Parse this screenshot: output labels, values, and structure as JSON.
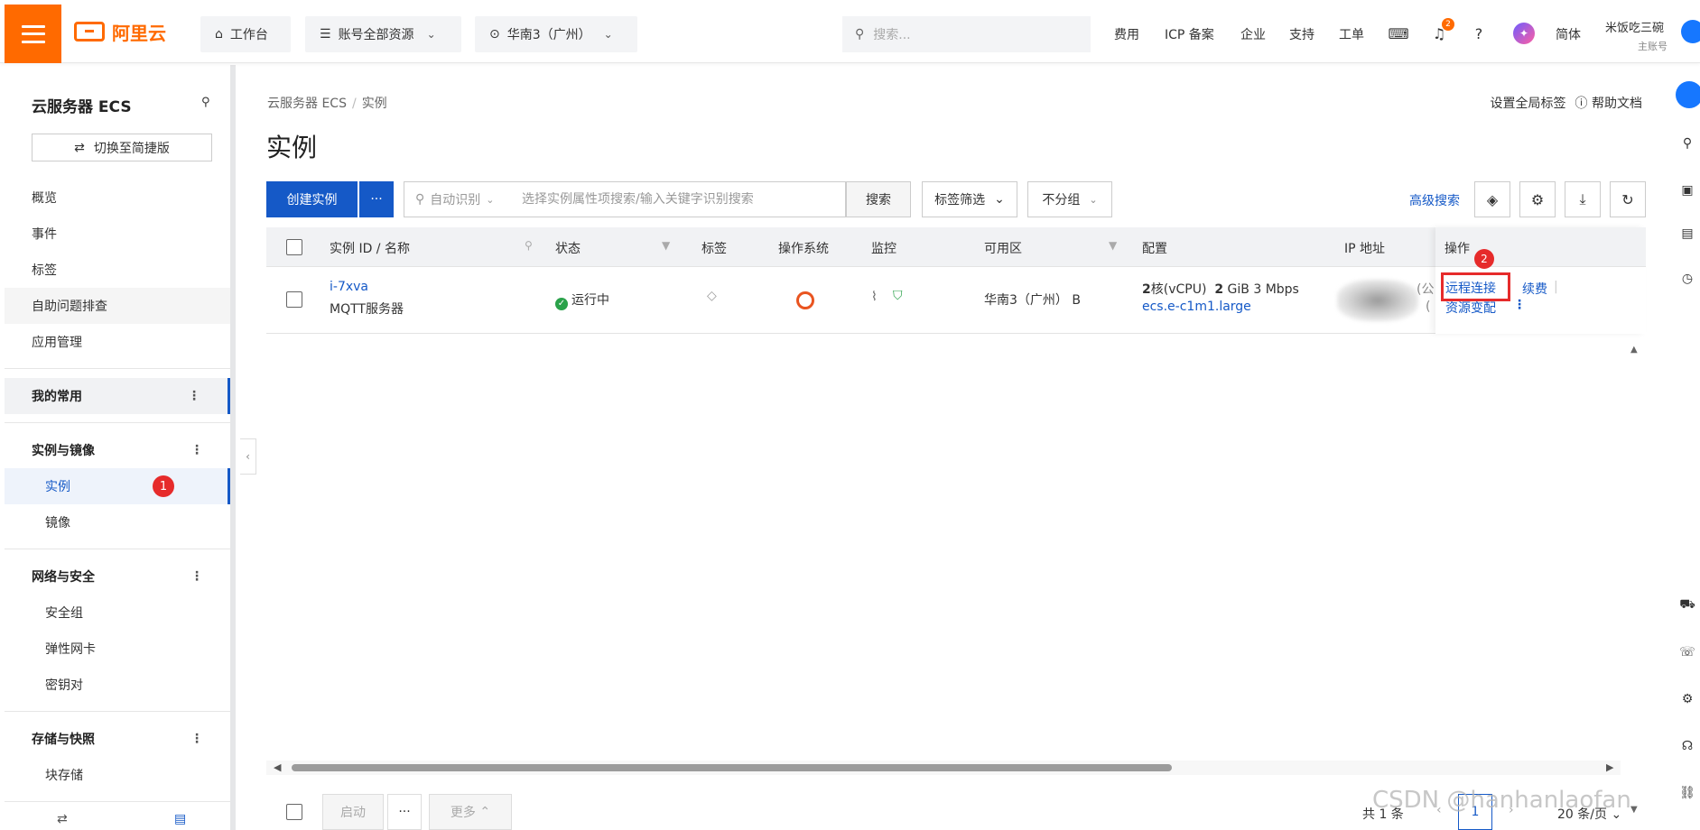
{
  "topbar": {
    "logo_text": "阿里云",
    "workbench": "工作台",
    "resources": "账号全部资源",
    "region": "华南3（广州）",
    "search_placeholder": "搜索...",
    "links": [
      "费用",
      "ICP 备案",
      "企业",
      "支持",
      "工单"
    ],
    "notif_count": "2",
    "lang": "简体",
    "user_name": "米饭吃三碗",
    "user_role": "主账号"
  },
  "sidebar": {
    "title": "云服务器 ECS",
    "switch_label": "切换至简捷版",
    "items": [
      "概览",
      "事件",
      "标签",
      "自助问题排查",
      "应用管理"
    ],
    "favorites": "我的常用",
    "group_instances": "实例与镜像",
    "instances": "实例",
    "images": "镜像",
    "group_network": "网络与安全",
    "security_group": "安全组",
    "eni": "弹性网卡",
    "keypair": "密钥对",
    "group_storage": "存储与快照",
    "block_storage": "块存储",
    "step1": "1"
  },
  "main": {
    "breadcrumb": [
      "云服务器 ECS",
      "实例"
    ],
    "title": "实例",
    "global_tag": "设置全局标签",
    "help_doc": "帮助文档",
    "create_btn": "创建实例",
    "create_more": "···",
    "search_mode": "自动识别",
    "search_placeholder": "选择实例属性项搜索/输入关键字识别搜索",
    "search_btn": "搜索",
    "tag_filter": "标签筛选",
    "group_select": "不分组",
    "advanced_search": "高级搜索"
  },
  "table": {
    "headers": [
      "实例 ID / 名称",
      "状态",
      "标签",
      "操作系统",
      "监控",
      "可用区",
      "配置",
      "IP 地址",
      "操作"
    ],
    "row": {
      "instance_id": "i-7xva",
      "instance_name": "MQTT服务器",
      "status": "运行中",
      "zone": "华南3（广州） B",
      "cpu_value": "2",
      "cpu_unit": "核(vCPU)",
      "mem_value": "2",
      "mem_unit": "GiB",
      "bandwidth": "3 Mbps",
      "spec": "ecs.e-c1m1.large",
      "ip_public_suffix": "(公",
      "ip_private_suffix": "(",
      "op_remote": "远程连接",
      "op_renew": "续费",
      "op_resize": "资源变配",
      "step2": "2"
    }
  },
  "footer": {
    "start_btn": "启动",
    "more_btn": "···",
    "more_menu": "更多",
    "total": "共 1 条",
    "page": "1",
    "page_size": "20 条/页"
  },
  "watermark": "CSDN @hanhanlaofan",
  "colors": {
    "brand": "#ff6a00",
    "primary": "#1559c7",
    "running": "#2aa24a",
    "marker": "#e62b2b"
  }
}
